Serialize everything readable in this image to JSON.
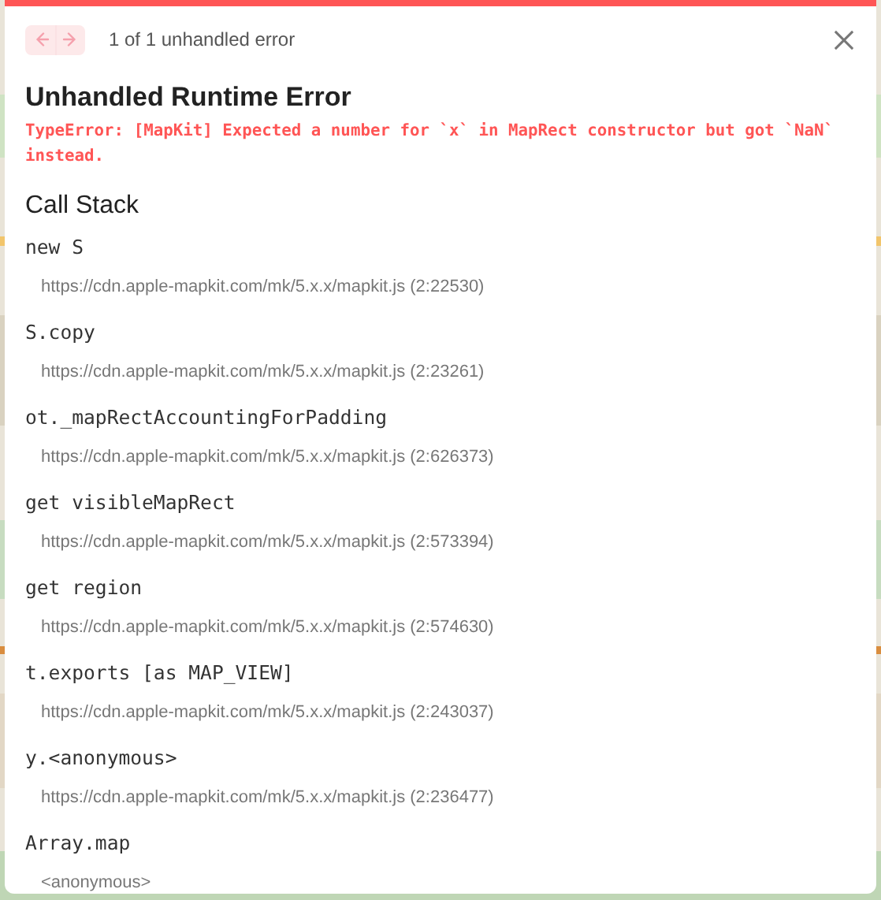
{
  "nav": {
    "buttons": [
      {
        "kind": "previous",
        "disabled": true
      },
      {
        "kind": "next",
        "disabled": true
      }
    ],
    "counter": "1 of 1 unhandled error"
  },
  "dialog": {
    "title": "Unhandled Runtime Error",
    "message": "TypeError: [MapKit] Expected a number for `x` in MapRect constructor but got `NaN` instead."
  },
  "call_stack": {
    "title": "Call Stack",
    "frames": [
      {
        "name": "new S",
        "location": "https://cdn.apple-mapkit.com/mk/5.x.x/mapkit.js (2:22530)"
      },
      {
        "name": "S.copy",
        "location": "https://cdn.apple-mapkit.com/mk/5.x.x/mapkit.js (2:23261)"
      },
      {
        "name": "ot._mapRectAccountingForPadding",
        "location": "https://cdn.apple-mapkit.com/mk/5.x.x/mapkit.js (2:626373)"
      },
      {
        "name": "get visibleMapRect",
        "location": "https://cdn.apple-mapkit.com/mk/5.x.x/mapkit.js (2:573394)"
      },
      {
        "name": "get region",
        "location": "https://cdn.apple-mapkit.com/mk/5.x.x/mapkit.js (2:574630)"
      },
      {
        "name": "t.exports [as MAP_VIEW]",
        "location": "https://cdn.apple-mapkit.com/mk/5.x.x/mapkit.js (2:243037)"
      },
      {
        "name": "y.<anonymous>",
        "location": "https://cdn.apple-mapkit.com/mk/5.x.x/mapkit.js (2:236477)"
      },
      {
        "name": "Array.map",
        "location": "<anonymous>"
      }
    ]
  }
}
